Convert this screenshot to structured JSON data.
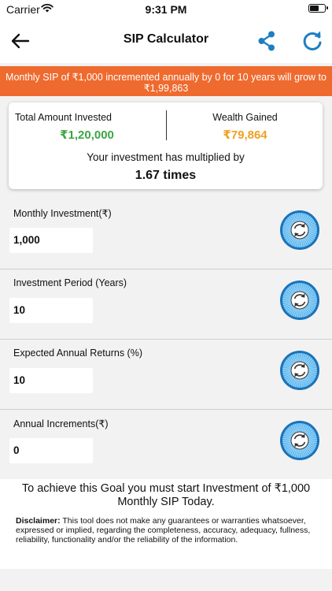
{
  "status_bar": {
    "carrier": "Carrier",
    "time": "9:31 PM"
  },
  "nav": {
    "title": "SIP Calculator"
  },
  "banner": {
    "text": "Monthly SIP of ₹1,000 incremented annually by 0 for 10 years will grow to ₹1,99,863"
  },
  "summary": {
    "invested_label": "Total Amount Invested",
    "invested_value": "₹1,20,000",
    "gained_label": "Wealth Gained",
    "gained_value": "₹79,864",
    "multiplied_label": "Your investment has multiplied by",
    "multiplied_value": "1.67 times"
  },
  "fields": [
    {
      "label": "Monthly Investment(₹)",
      "value": "1,000"
    },
    {
      "label": "Investment Period (Years)",
      "value": "10"
    },
    {
      "label": "Expected Annual Returns (%)",
      "value": "10"
    },
    {
      "label": "Annual Increments(₹)",
      "value": "0"
    }
  ],
  "goal": {
    "text": "To achieve this Goal you must start Investment of ₹1,000 Monthly SIP Today.",
    "disclaimer_label": "Disclaimer:",
    "disclaimer_text": " This tool does not make any guarantees or warranties whatsoever, expressed or implied, regarding the completeness, accuracy, adequacy, fullness, reliability, functionality and/or the reliability of the information."
  },
  "colors": {
    "accent": "#1e7fc0",
    "banner": "#ef6a2e",
    "green": "#3aa545",
    "amber": "#f0a020",
    "reset_ring": "#1a72b8",
    "reset_fill": "#59b6ef"
  },
  "icons": {
    "back": "arrow-left-icon",
    "share": "share-icon",
    "refresh": "refresh-icon",
    "reset": "reset-icon",
    "wifi": "wifi-icon",
    "battery": "battery-icon"
  }
}
